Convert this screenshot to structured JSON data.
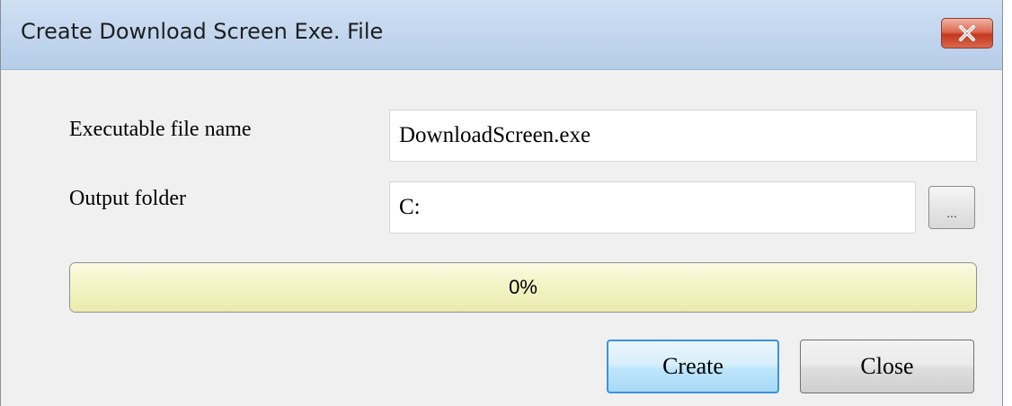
{
  "window": {
    "title": "Create Download Screen Exe. File"
  },
  "form": {
    "exe_label": "Executable file name",
    "exe_value": "DownloadScreen.exe",
    "folder_label": "Output folder",
    "folder_value": "C:",
    "browse_label": "..."
  },
  "progress": {
    "value_percent": 0,
    "label": "0%"
  },
  "buttons": {
    "create_label": "Create",
    "close_label": "Close"
  },
  "icons": {
    "title_close": "close-icon"
  },
  "colors": {
    "close_button": "#d24b33",
    "progress_track": "#f4f4c8",
    "primary_border": "#3c94d6"
  }
}
